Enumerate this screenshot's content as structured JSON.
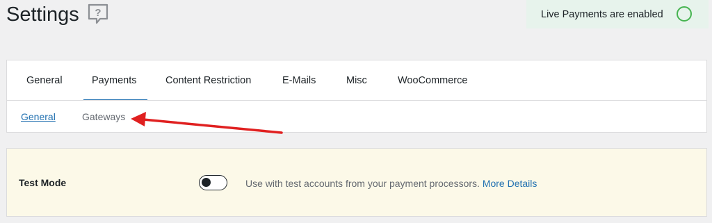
{
  "header": {
    "title": "Settings",
    "help_icon": "help-question-icon"
  },
  "notice": {
    "text": "Live Payments are enabled",
    "status_icon": "status-ring-icon",
    "status_color": "#46b450"
  },
  "tabs": [
    {
      "label": "General",
      "active": false
    },
    {
      "label": "Payments",
      "active": true
    },
    {
      "label": "Content Restriction",
      "active": false
    },
    {
      "label": "E-Mails",
      "active": false
    },
    {
      "label": "Misc",
      "active": false
    },
    {
      "label": "WooCommerce",
      "active": false
    }
  ],
  "subtabs": [
    {
      "label": "General",
      "active": true
    },
    {
      "label": "Gateways",
      "active": false
    }
  ],
  "annotation": {
    "arrow_color": "#e02020"
  },
  "settings": {
    "test_mode": {
      "label": "Test Mode",
      "enabled": false,
      "description": "Use with test accounts from your payment processors.",
      "link_text": "More Details"
    }
  },
  "colors": {
    "accent": "#2271b1",
    "notice_bg": "#e7f3ec",
    "highlight_bg": "#fcf9e8"
  }
}
